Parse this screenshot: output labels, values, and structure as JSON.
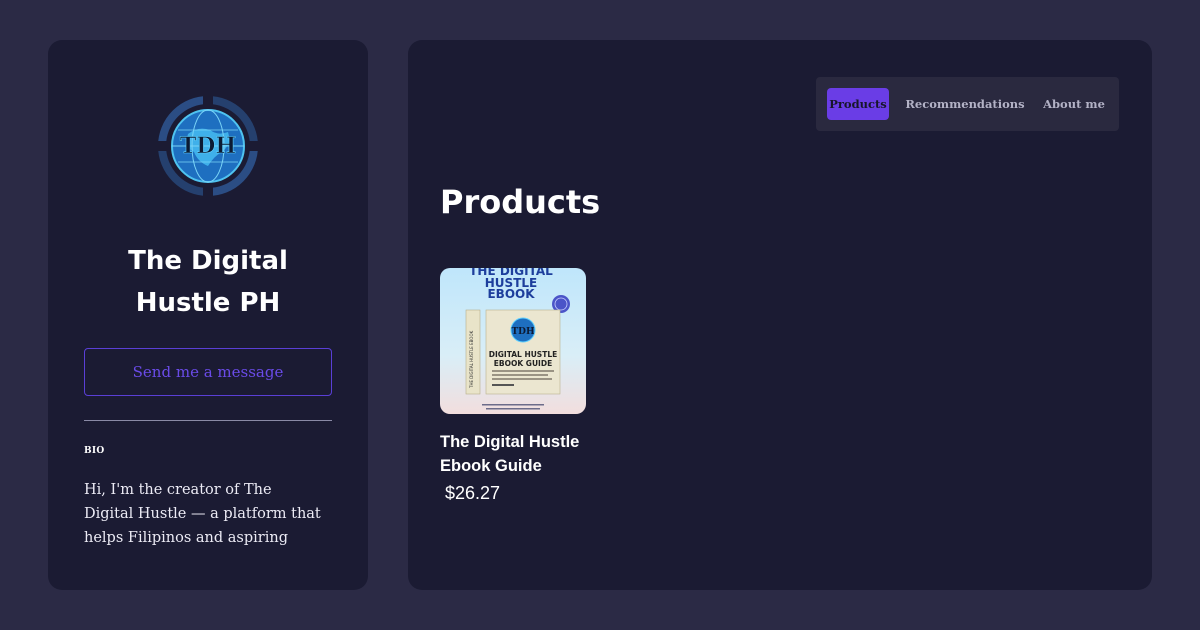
{
  "profile": {
    "logo_icon": "tdh-globe-logo",
    "name": "The Digital Hustle PH",
    "message_button_label": "Send me a message",
    "bio_heading": "BIO",
    "bio_text": "Hi, I'm the creator of The Digital Hustle — a platform that helps Filipinos and aspiring digital"
  },
  "nav": {
    "items": [
      {
        "label": "Products",
        "active": true
      },
      {
        "label": "Recommendations",
        "active": false
      },
      {
        "label": "About me",
        "active": false
      }
    ]
  },
  "main": {
    "section_title": "Products",
    "products": [
      {
        "title": "The Digital Hustle Ebook Guide",
        "price": "$26.27",
        "cover_text": {
          "headline": "THE DIGITAL HUSTLE EBOOK",
          "book_title_1": "DIGITAL HUSTLE",
          "book_title_2": "EBOOK GUIDE",
          "spine": "THE DIGITAL HUSTLE EBOOK",
          "logo_letters": "TDH"
        }
      }
    ]
  },
  "colors": {
    "page_bg": "#2b2a45",
    "panel_bg": "#1b1b33",
    "accent": "#6a3de6",
    "nav_bg": "#2a293f"
  }
}
